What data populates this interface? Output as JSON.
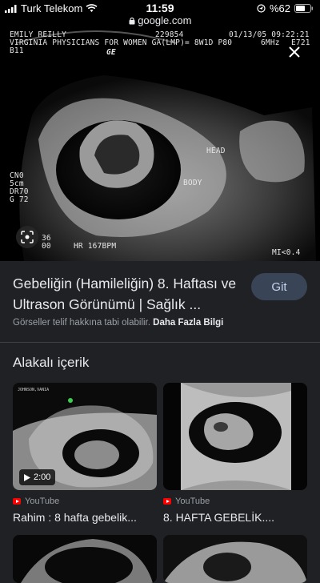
{
  "status_bar": {
    "carrier": "Turk Telekom",
    "time": "11:59",
    "battery": "%62"
  },
  "url": "google.com",
  "image": {
    "overlay": {
      "name": "EMILY REILLY",
      "patient_id": "229854",
      "datetime": "01/13/05 09:22:21",
      "facility": "VIRGINIA PHYSICIANS FOR WOMEN GA(LMP)= 8W1D P80",
      "freq": "6MHz",
      "probe": "E721",
      "code": "B11",
      "logo": "GE",
      "label_head": "HEAD",
      "label_body": "BODY",
      "left_params": [
        "CN0",
        "5cm",
        "DR70",
        "G 72"
      ],
      "bottom_left": [
        "36",
        "00"
      ],
      "heart_rate": "HR 167BPM",
      "mi": "MI<0.4"
    }
  },
  "result": {
    "title": "Gebeliğin (Hamileliğin) 8. Haftası ve Ultrason Görünümü | Sağlık ...",
    "visit_label": "Git",
    "copyright_text": "Görseller telif hakkına tabi olabilir.",
    "more_info_label": "Daha Fazla Bilgi"
  },
  "related": {
    "heading": "Alakalı içerik",
    "cards": [
      {
        "duration": "2:00",
        "source": "YouTube",
        "title": "Rahim : 8 hafta gebelik..."
      },
      {
        "source": "YouTube",
        "title": "8. HAFTA GEBELİK...."
      }
    ]
  },
  "colors": {
    "background": "#202124",
    "button_bg": "#394457",
    "youtube_red": "#ff0000"
  },
  "icons": [
    "wifi-icon",
    "location-icon",
    "lock-icon",
    "battery-icon",
    "close-icon",
    "google-lens-icon",
    "play-icon",
    "youtube-icon"
  ]
}
